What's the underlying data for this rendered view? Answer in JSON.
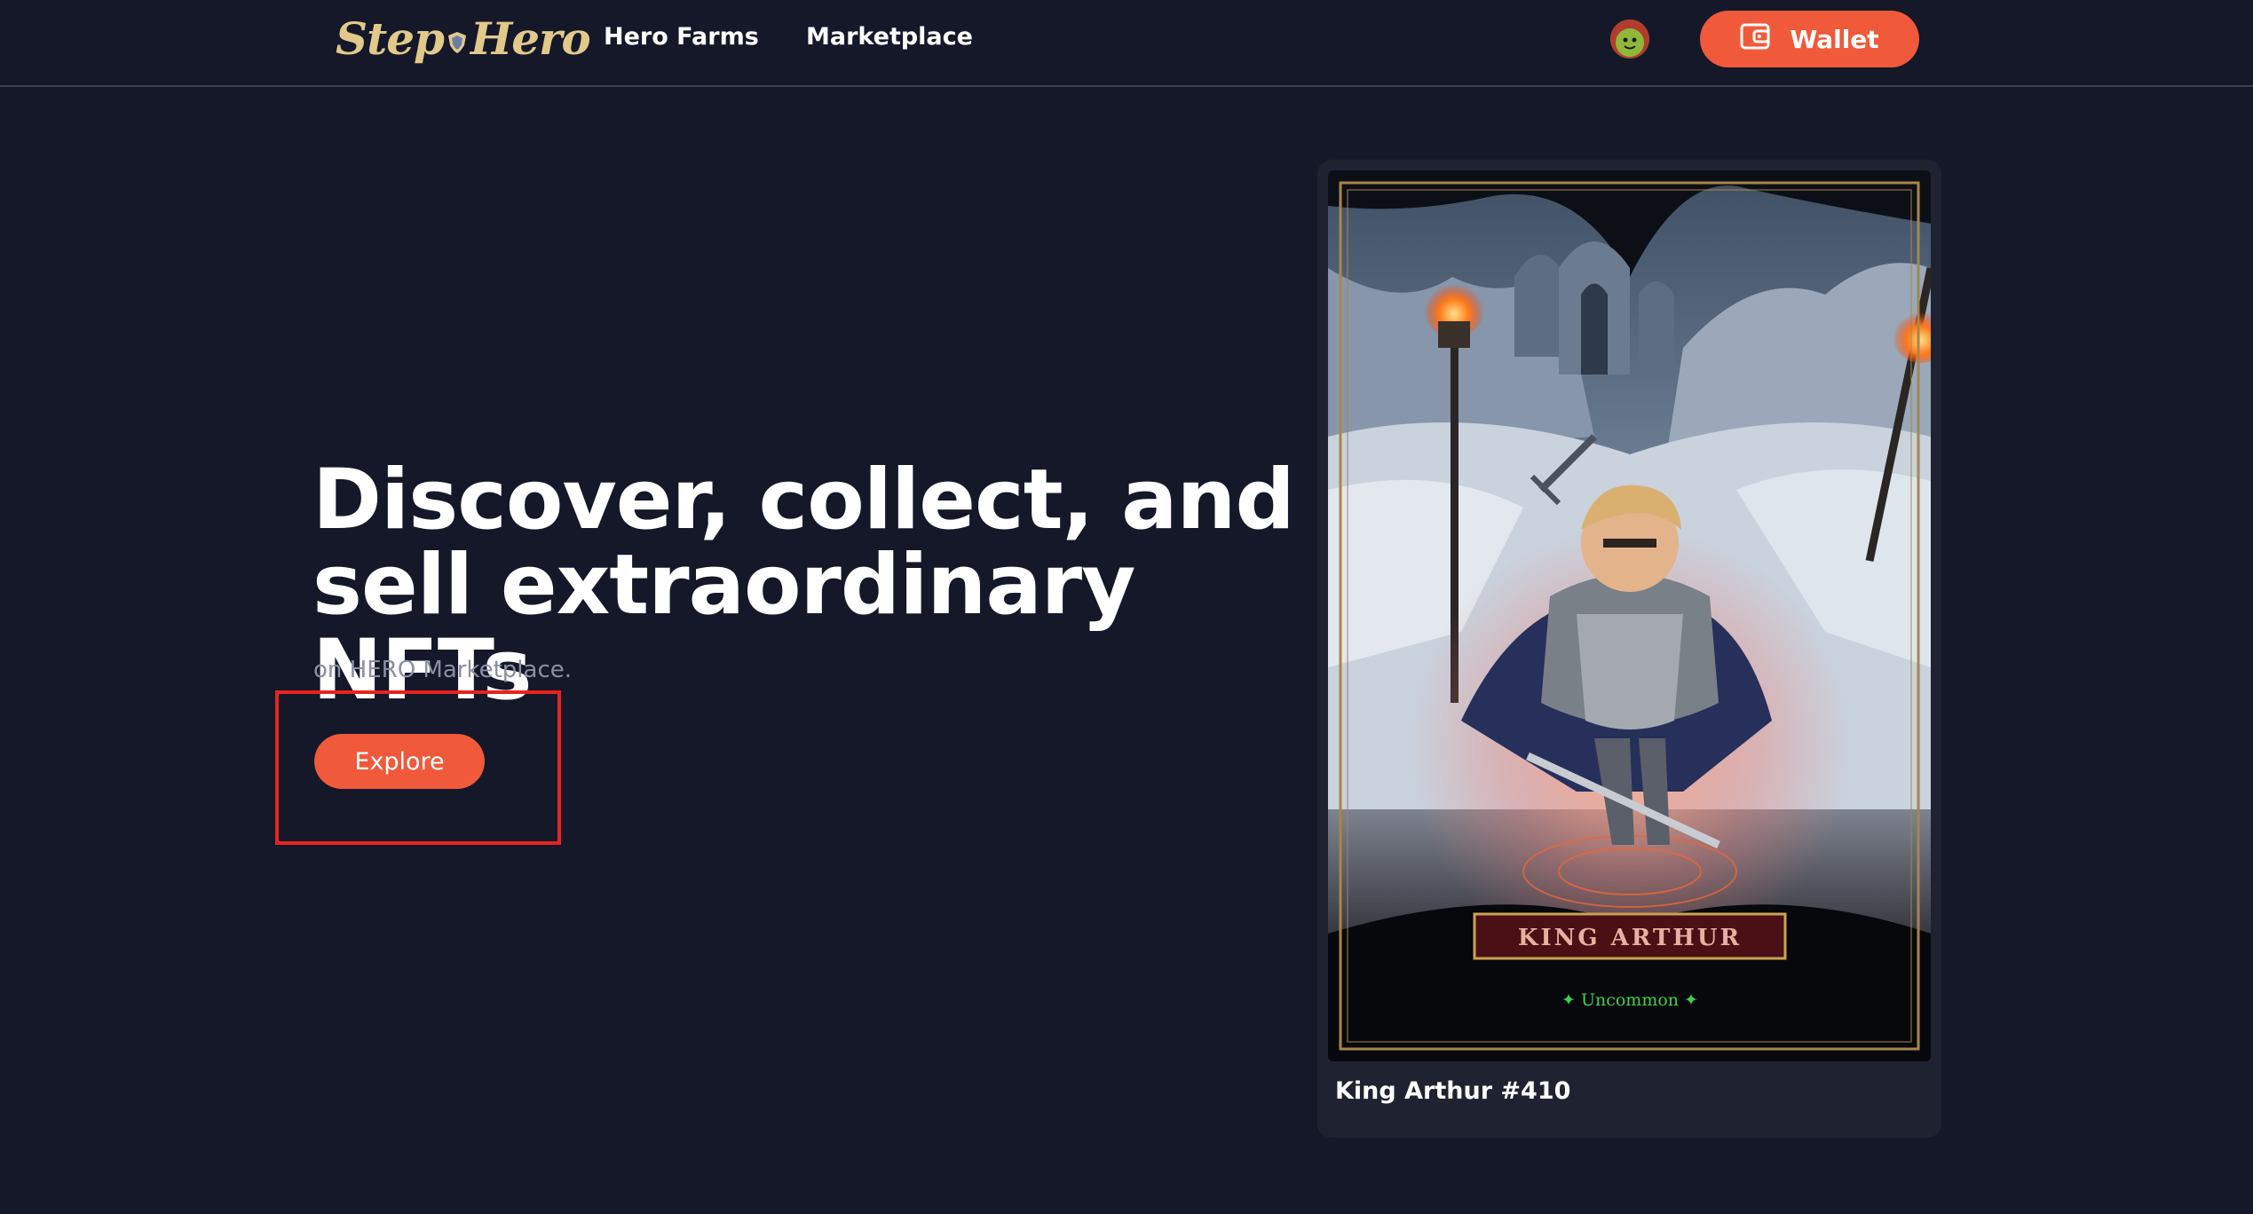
{
  "nav": {
    "logo_text_left": "Step",
    "logo_text_right": "Hero",
    "links": [
      "Hero Farms",
      "Marketplace"
    ],
    "wallet_label": "Wallet",
    "wallet_icon": "wallet-icon",
    "avatar_icon": "avatar-icon"
  },
  "hero": {
    "title_line1": "Discover, collect, and",
    "title_line2": "sell extraordinary NFTs",
    "subtitle": "on HERO Marketplace.",
    "cta_label": "Explore"
  },
  "featured_card": {
    "art_title": "KING ARTHUR",
    "rarity": "✦ Uncommon ✦",
    "name": "King Arthur #410"
  },
  "colors": {
    "background": "#141829",
    "accent": "#f0593a",
    "card_bg": "#1f2331",
    "highlight": "#e8231f",
    "rarity": "#3fd04f",
    "logo": "#e2c98a"
  }
}
